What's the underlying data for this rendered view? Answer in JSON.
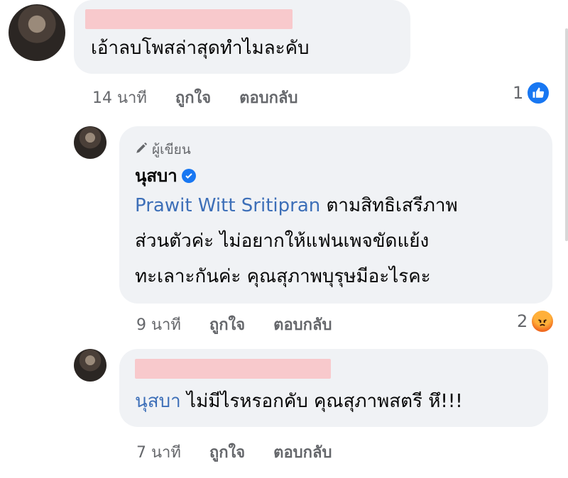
{
  "comments": [
    {
      "text": "เอ้าลบโพสล่าสุดทำไมละคับ",
      "time": "14 นาที",
      "like_label": "ถูกใจ",
      "reply_label": "ตอบกลับ",
      "reaction_count": "1",
      "reaction_icon": "like-icon"
    },
    {
      "author_badge": "ผู้เขียน",
      "name": "นุสบา",
      "mention": "Prawit Witt Sritipran",
      "text_line1": "ตามสิทธิเสรีภาพ",
      "text_line2": "ส่วนตัวค่ะ ไม่อยากให้แฟนเพจขัดแย้ง",
      "text_line3": "ทะเลาะกันค่ะ คุณสุภาพบุรุษมีอะไรคะ",
      "time": "9 นาที",
      "like_label": "ถูกใจ",
      "reply_label": "ตอบกลับ",
      "reaction_count": "2",
      "reaction_icon": "angry-icon"
    },
    {
      "mention": "นุสบา",
      "text": "ไม่มีไรหรอกคับ คุณสุภาพสตรี หึ!!!",
      "time": "7 นาที",
      "like_label": "ถูกใจ",
      "reply_label": "ตอบกลับ"
    }
  ],
  "colors": {
    "bubble": "#f0f2f5",
    "link": "#3d6fb8",
    "meta": "#65676b",
    "redaction": "#f8c9cc",
    "like": "#1877f2"
  }
}
